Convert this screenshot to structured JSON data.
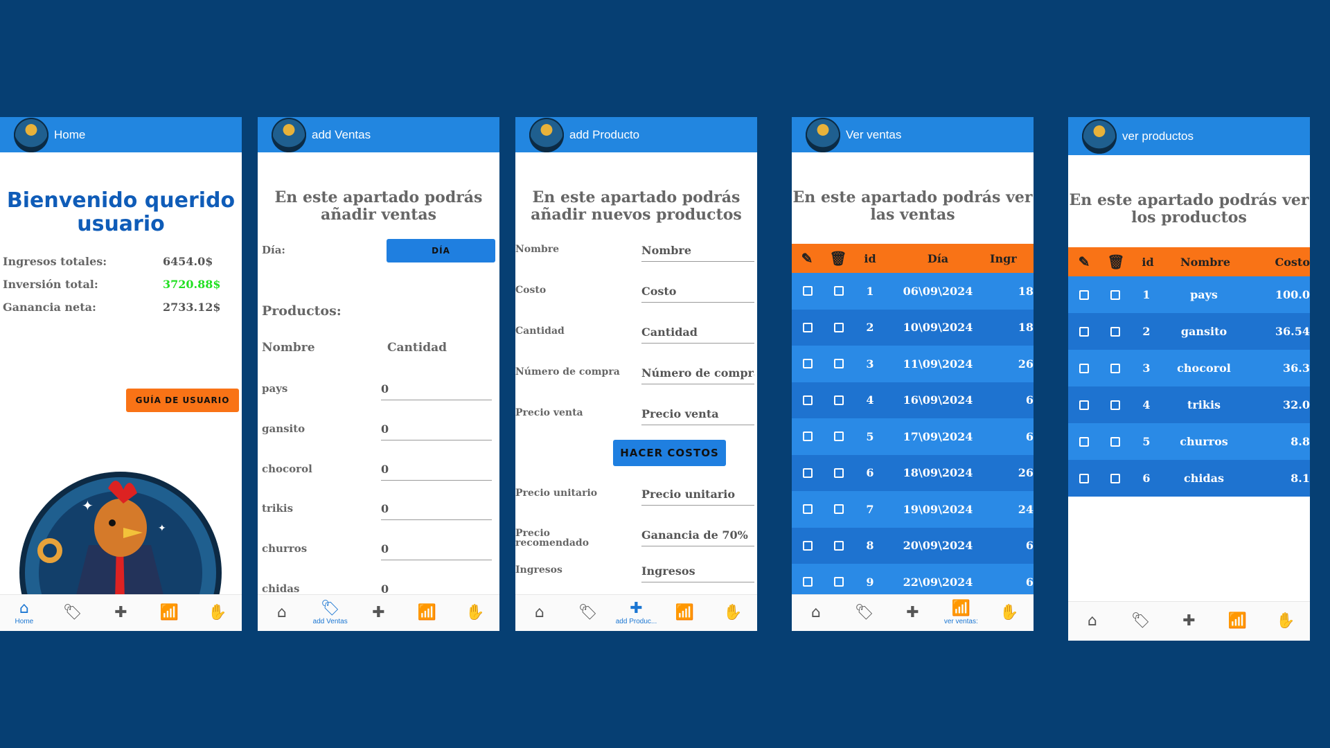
{
  "colors": {
    "background": "#063f73",
    "appbar": "#2286e0",
    "accent_orange": "#f97316",
    "row_light": "#2a8ae6",
    "row_dark": "#1e73d0",
    "green": "#22e022"
  },
  "nav": {
    "icons": [
      "home-icon",
      "tag-icon",
      "add-icon",
      "chart-icon",
      "hand-icon"
    ],
    "glyphs": [
      "⌂",
      "🏷",
      "✚",
      "📶",
      "✋"
    ]
  },
  "home": {
    "title": "Home",
    "welcome_line1": "Bienvenido querido",
    "welcome_line2": "usuario",
    "rows": [
      {
        "label": "Ingresos totales:",
        "value": "6454.0$"
      },
      {
        "label": "Inversión total:",
        "value": "3720.88$"
      },
      {
        "label": "Ganancia neta:",
        "value": "2733.12$"
      }
    ],
    "guide_button": "GUÍA DE USUARIO",
    "nav_label": "Home"
  },
  "ventas": {
    "title": "add Ventas",
    "intro_line1": "En este apartado podrás",
    "intro_line2": "añadir ventas",
    "dia_label": "Día:",
    "dia_button": "DÍA",
    "productos_label": "Productos:",
    "col_nombre": "Nombre",
    "col_cantidad": "Cantidad",
    "items": [
      {
        "name": "pays",
        "qty": "0"
      },
      {
        "name": "gansito",
        "qty": "0"
      },
      {
        "name": "chocorol",
        "qty": "0"
      },
      {
        "name": "trikis",
        "qty": "0"
      },
      {
        "name": "churros",
        "qty": "0"
      },
      {
        "name": "chidas",
        "qty": "0"
      }
    ],
    "nav_label": "add Ventas"
  },
  "producto": {
    "title": "add Producto",
    "intro_line1": "En este apartado podrás",
    "intro_line2": "añadir nuevos productos",
    "fields": [
      {
        "label": "Nombre",
        "placeholder": "Nombre"
      },
      {
        "label": "Costo",
        "placeholder": "Costo"
      },
      {
        "label": "Cantidad",
        "placeholder": "Cantidad"
      },
      {
        "label": "Número de compra",
        "placeholder": "Número de compra"
      },
      {
        "label": "Precio venta",
        "placeholder": "Precio venta"
      }
    ],
    "costos_button": "HACER COSTOS",
    "precio_unitario_label": "Precio unitario",
    "precio_unitario_value": "Precio unitario",
    "precio_rec_label1": "Precio",
    "precio_rec_label2": "recomendado",
    "precio_rec_value": "Ganancia de 70%",
    "ingresos_label": "Ingresos",
    "ingresos_value": "Ingresos",
    "nav_label": "add Produc..."
  },
  "ver_ventas": {
    "title": "Ver ventas",
    "intro_line1": "En este apartado podrás ver",
    "intro_line2": "las ventas",
    "col_id": "id",
    "col_dia": "Día",
    "col_ingresos": "Ingr",
    "rows": [
      {
        "id": "1",
        "dia": "06\\09\\2024",
        "ing": "18"
      },
      {
        "id": "2",
        "dia": "10\\09\\2024",
        "ing": "18"
      },
      {
        "id": "3",
        "dia": "11\\09\\2024",
        "ing": "26"
      },
      {
        "id": "4",
        "dia": "16\\09\\2024",
        "ing": "6"
      },
      {
        "id": "5",
        "dia": "17\\09\\2024",
        "ing": "6"
      },
      {
        "id": "6",
        "dia": "18\\09\\2024",
        "ing": "26"
      },
      {
        "id": "7",
        "dia": "19\\09\\2024",
        "ing": "24"
      },
      {
        "id": "8",
        "dia": "20\\09\\2024",
        "ing": "6"
      },
      {
        "id": "9",
        "dia": "22\\09\\2024",
        "ing": "6"
      }
    ],
    "nav_label": "ver ventas:"
  },
  "ver_productos": {
    "title": "ver productos",
    "intro_line1": "En este apartado podrás ver",
    "intro_line2": "los productos",
    "col_id": "id",
    "col_nombre": "Nombre",
    "col_costo": "Costo",
    "rows": [
      {
        "id": "1",
        "nombre": "pays",
        "costo": "100.0"
      },
      {
        "id": "2",
        "nombre": "gansito",
        "costo": "36.54"
      },
      {
        "id": "3",
        "nombre": "chocorol",
        "costo": "36.3"
      },
      {
        "id": "4",
        "nombre": "trikis",
        "costo": "32.0"
      },
      {
        "id": "5",
        "nombre": "churros",
        "costo": "8.8"
      },
      {
        "id": "6",
        "nombre": "chidas",
        "costo": "8.1"
      }
    ]
  }
}
